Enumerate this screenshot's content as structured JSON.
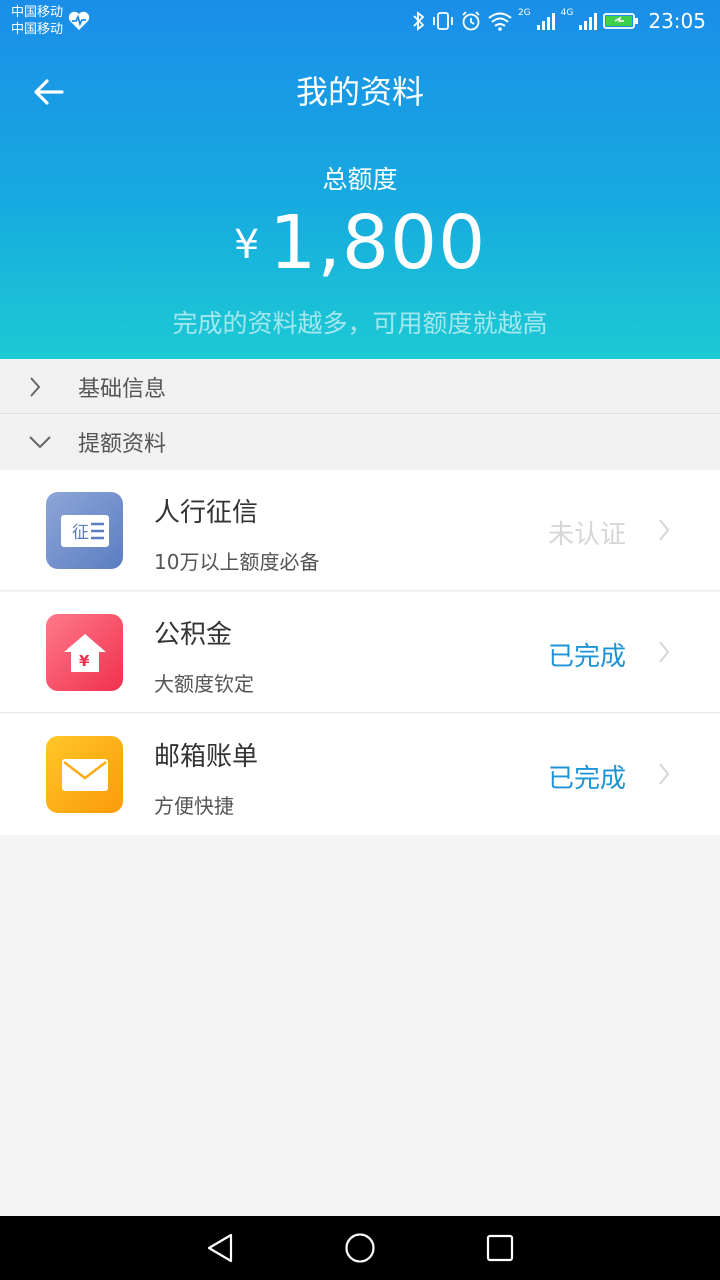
{
  "status_bar": {
    "carrier_1": "中国移动",
    "carrier_2": "中国移动",
    "network_1": "2G",
    "network_2": "4G",
    "time": "23:05"
  },
  "header": {
    "title": "我的资料",
    "quota_label": "总额度",
    "currency": "¥",
    "amount": "1,800",
    "hint": "完成的资料越多，可用额度就越高"
  },
  "sections": {
    "basic_info": "基础信息",
    "quota_materials": "提额资料"
  },
  "items": [
    {
      "title": "人行征信",
      "subtitle": "10万以上额度必备",
      "status": "未认证",
      "icon": "credit-report-icon",
      "icon_text": "征",
      "color": "#6d8cc8"
    },
    {
      "title": "公积金",
      "subtitle": "大额度钦定",
      "status": "已完成",
      "icon": "house-fund-icon",
      "icon_text": "¥",
      "color": "#f5485f"
    },
    {
      "title": "邮箱账单",
      "subtitle": "方便快捷",
      "status": "已完成",
      "icon": "mail-icon",
      "color": "#fcab0c"
    }
  ],
  "colors": {
    "header_top": "#1a8ee8",
    "header_bottom": "#1ccad3",
    "status_done": "#1e93d6",
    "status_pending": "#d6d6d6"
  }
}
